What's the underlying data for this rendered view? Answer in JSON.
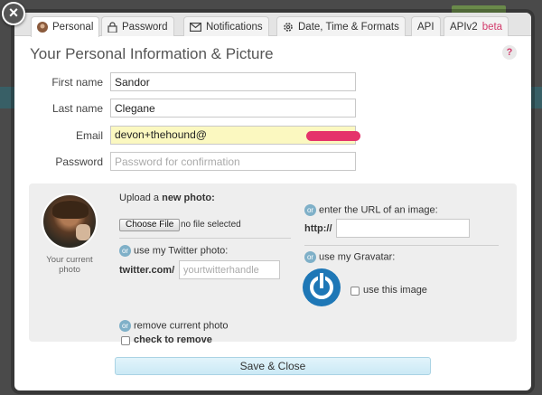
{
  "tabs": [
    {
      "label": "Personal",
      "icon": "user-avatar-icon"
    },
    {
      "label": "Password",
      "icon": "lock-icon"
    },
    {
      "label": "Notifications",
      "icon": "envelope-icon"
    },
    {
      "label": "Date, Time & Formats",
      "icon": "gear-icon"
    },
    {
      "label": "API"
    },
    {
      "label": "APIv2",
      "badge": "beta"
    }
  ],
  "close_glyph": "×",
  "title": "Your Personal Information & Picture",
  "help_glyph": "?",
  "form": {
    "first_name_label": "First name",
    "first_name_value": "Sandor",
    "last_name_label": "Last name",
    "last_name_value": "Clegane",
    "email_label": "Email",
    "email_value": "devon+thehound@",
    "password_label": "Password",
    "password_placeholder": "Password for confirmation"
  },
  "photo": {
    "caption": "Your current photo",
    "upload_prefix": "Upload a ",
    "upload_bold": "new photo:",
    "choose_button": "Choose File",
    "no_file": "no file selected",
    "or_label": "or",
    "twitter_label": "use my Twitter photo:",
    "twitter_prefix": "twitter.com/",
    "twitter_placeholder": "yourtwitterhandle",
    "remove_label": "remove current photo",
    "check_to_remove": "check to remove",
    "url_label": "enter the URL of an image:",
    "http_prefix": "http://",
    "gravatar_label": "use my Gravatar:",
    "use_this_image": "use this image"
  },
  "save_button": "Save & Close",
  "colors": {
    "accent_pink": "#d23b6b",
    "or_blue": "#7fb0c8",
    "gravatar_blue": "#1e77b6",
    "email_highlight": "#fbf8c0"
  }
}
